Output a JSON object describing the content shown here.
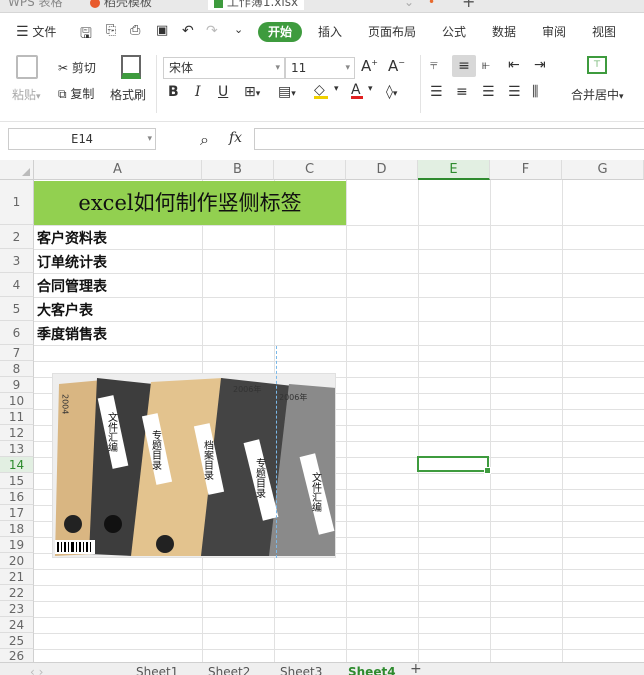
{
  "window_tabs": [
    {
      "label": "WPS 表格"
    },
    {
      "label": "稻壳模板"
    },
    {
      "label": "工作簿1.xlsx"
    }
  ],
  "menu": {
    "file": "文件",
    "tabs": [
      "开始",
      "插入",
      "页面布局",
      "公式",
      "数据",
      "审阅",
      "视图"
    ]
  },
  "ribbon": {
    "paste": "粘贴",
    "cut": "剪切",
    "copy": "复制",
    "format_painter": "格式刷",
    "font_name": "宋体",
    "font_size": "11",
    "merge_center": "合并居中"
  },
  "formula_bar": {
    "name_box": "E14",
    "fx": "fx",
    "formula": ""
  },
  "grid": {
    "columns": [
      "A",
      "B",
      "C",
      "D",
      "E",
      "F",
      "G"
    ],
    "selected_column": "E",
    "rows": [
      "1",
      "2",
      "3",
      "4",
      "5",
      "6",
      "7",
      "8",
      "9",
      "10",
      "11",
      "12",
      "13",
      "14",
      "15",
      "16",
      "17",
      "18",
      "19",
      "20",
      "21",
      "22",
      "23",
      "24",
      "25",
      "26"
    ],
    "selected_row": "14",
    "title_cell": "excel如何制作竖侧标签",
    "title_fill": "#92d050",
    "items": [
      "客户资料表",
      "订单统计表",
      "合同管理表",
      "大客户表",
      "季度销售表"
    ],
    "selection_color": "#3e9b3e"
  },
  "picture": {
    "binder_labels": [
      "文件汇编",
      "专题目录",
      "档案目录",
      "专题目录",
      "文件汇编"
    ],
    "years": [
      "2004",
      "2006年",
      "2006年"
    ]
  },
  "sheets": [
    "Sheet1",
    "Sheet2",
    "Sheet3",
    "Sheet4"
  ],
  "active_sheet": "Sheet4"
}
